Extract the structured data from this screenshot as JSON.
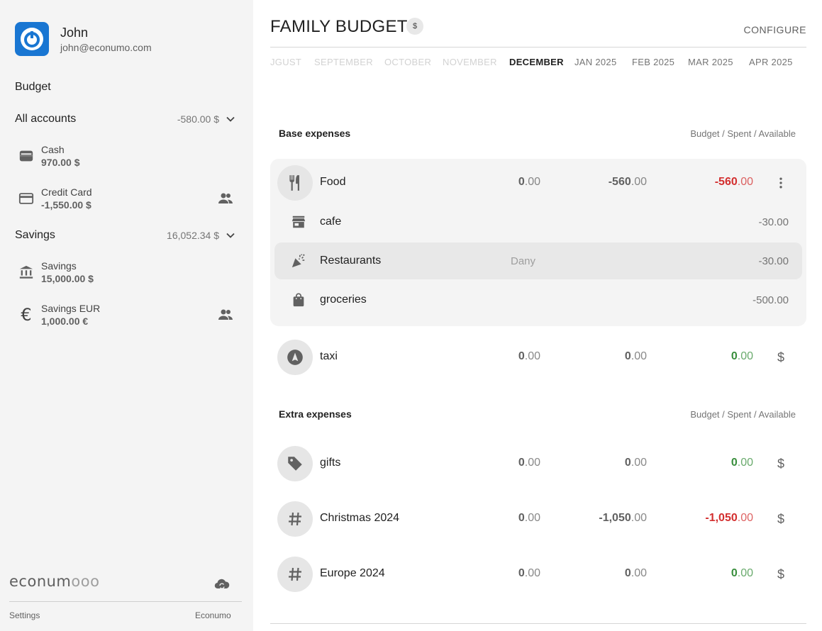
{
  "user": {
    "name": "John",
    "email": "john@econumo.com"
  },
  "sidebar": {
    "budget_heading": "Budget",
    "groups": [
      {
        "label": "All accounts",
        "total": "-580.00 $",
        "accounts": [
          {
            "name": "Cash",
            "balance": "970.00 $",
            "icon": "wallet-icon",
            "shared": false
          },
          {
            "name": "Credit Card",
            "balance": "-1,550.00 $",
            "icon": "credit-card-icon",
            "shared": true
          }
        ]
      },
      {
        "label": "Savings",
        "total": "16,052.34 $",
        "accounts": [
          {
            "name": "Savings",
            "balance": "15,000.00 $",
            "icon": "bank-icon",
            "shared": false
          },
          {
            "name": "Savings EUR",
            "balance": "1,000.00 €",
            "icon": "euro-icon",
            "shared": true
          }
        ]
      }
    ],
    "logo_text": "econum",
    "logo_rings": "ooo",
    "footer_left": "Settings",
    "footer_right": "Econumo"
  },
  "header": {
    "title": "FAMILY BUDGET",
    "currency_symbol": "$",
    "configure_label": "CONFIGURE",
    "months": [
      "JGUST",
      "SEPTEMBER",
      "OCTOBER",
      "NOVEMBER",
      "DECEMBER",
      "JAN 2025",
      "FEB 2025",
      "MAR 2025",
      "APR 2025"
    ],
    "active_month": "DECEMBER"
  },
  "sections": [
    {
      "title": "Base expenses",
      "columns": "Budget / Spent / Available",
      "categories": [
        {
          "name": "Food",
          "icon": "utensils-icon",
          "budget": {
            "int": "0",
            "dec": ".00"
          },
          "spent": {
            "int": "-560",
            "dec": ".00"
          },
          "available": {
            "int": "-560",
            "dec": ".00",
            "status": "negative"
          },
          "action": "more-vert",
          "subcategories": [
            {
              "name": "cafe",
              "icon": "store-icon",
              "owner": "",
              "amount": "-30.00"
            },
            {
              "name": "Restaurants",
              "icon": "party-popper-icon",
              "owner": "Dany",
              "amount": "-30.00"
            },
            {
              "name": "groceries",
              "icon": "shopping-bag-icon",
              "owner": "",
              "amount": "-500.00"
            }
          ]
        },
        {
          "name": "taxi",
          "icon": "navigation-icon",
          "budget": {
            "int": "0",
            "dec": ".00"
          },
          "spent": {
            "int": "0",
            "dec": ".00"
          },
          "available": {
            "int": "0",
            "dec": ".00",
            "status": "positive"
          },
          "action": "$"
        }
      ]
    },
    {
      "title": "Extra expenses",
      "columns": "Budget / Spent / Available",
      "categories": [
        {
          "name": "gifts",
          "icon": "tag-icon",
          "budget": {
            "int": "0",
            "dec": ".00"
          },
          "spent": {
            "int": "0",
            "dec": ".00"
          },
          "available": {
            "int": "0",
            "dec": ".00",
            "status": "positive"
          },
          "action": "$"
        },
        {
          "name": "Christmas 2024",
          "icon": "hashtag-icon",
          "budget": {
            "int": "0",
            "dec": ".00"
          },
          "spent": {
            "int": "-1,050",
            "dec": ".00"
          },
          "available": {
            "int": "-1,050",
            "dec": ".00",
            "status": "negative"
          },
          "action": "$"
        },
        {
          "name": "Europe 2024",
          "icon": "hashtag-icon",
          "budget": {
            "int": "0",
            "dec": ".00"
          },
          "spent": {
            "int": "0",
            "dec": ".00"
          },
          "available": {
            "int": "0",
            "dec": ".00",
            "status": "positive"
          },
          "action": "$"
        }
      ]
    }
  ],
  "colors": {
    "brand": "#1976d2",
    "negative": "#d32f2f",
    "positive": "#388e3c"
  }
}
